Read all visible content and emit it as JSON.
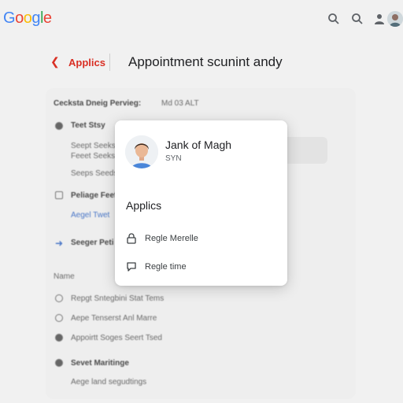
{
  "app": {
    "logo_letters": [
      "G",
      "o",
      "o",
      "g",
      "l",
      "e"
    ],
    "logo_colors": [
      "#4285f4",
      "#ea4335",
      "#fbbc05",
      "#4285f4",
      "#34a853",
      "#ea4335"
    ]
  },
  "topbar": {
    "icons": [
      "search-icon",
      "search-icon",
      "account-icon"
    ]
  },
  "header": {
    "back_label": "Applics",
    "title": "Appointment scunint andy"
  },
  "background": {
    "section_title": "Cecksta Dneig Pervieg:",
    "section_meta": "Md 03 ALT",
    "row1_title": "Teet Stsy",
    "row1_line1": "Seept Seeks",
    "row1_line2": "Feeet Seeks",
    "row1_line3": "Seeps Seeds",
    "row2_title": "Peliage Feefs",
    "row2_link": "Aegel Twet",
    "row3_title": "Seeger Peti",
    "label_name": "Name",
    "opt1": "Repgt Sntegbini Stat Tems",
    "opt2": "Aepe Tenserst Anl Marre",
    "opt3": "Appoirtt Soges Seert Tsed",
    "row4_title": "Sevet Maritinge",
    "row4_line": "Aege land segudtings"
  },
  "card": {
    "name": "Jank of Magh",
    "subtitle": "SYN",
    "section_title": "Applics",
    "items": [
      {
        "label": "Regle Merelle",
        "icon": "lock-icon"
      },
      {
        "label": "Regle time",
        "icon": "chat-bubble-icon"
      }
    ]
  }
}
